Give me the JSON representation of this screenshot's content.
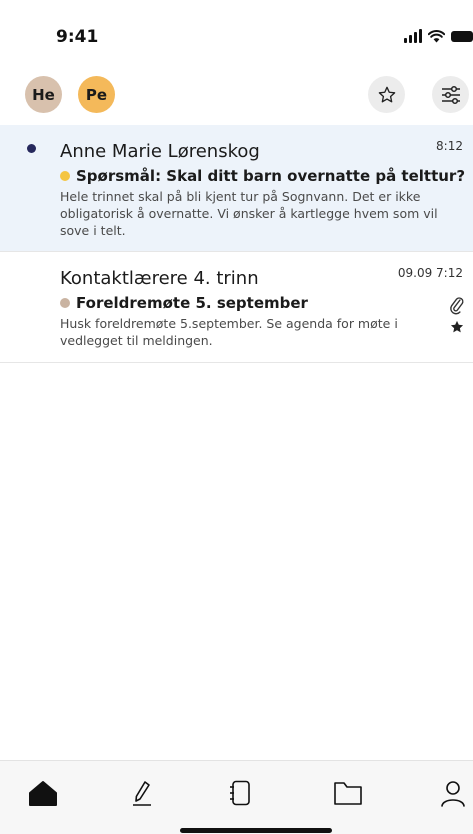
{
  "status_bar": {
    "time": "9:41"
  },
  "header": {
    "avatars": [
      {
        "initials": "He",
        "color": "#d8c1ad"
      },
      {
        "initials": "Pe",
        "color": "#f4b95a"
      }
    ],
    "buttons": [
      "star-icon",
      "filter-icon"
    ]
  },
  "messages": [
    {
      "sender": "Anne Marie Lørenskog",
      "time": "8:12",
      "subject": "Spørsmål: Skal ditt barn overnatte på telttur?",
      "subject_dot_color": "#f4c542",
      "preview": "Hele trinnet skal på bli kjent tur på Sognvann. Det er ikke obligatorisk å overnatte. Vi ønsker å kartlegge hvem som vil sove i telt.",
      "unread": true
    },
    {
      "sender": "Kontaktlærere 4. trinn",
      "time": "09.09 7:12",
      "subject": "Foreldremøte 5. september",
      "subject_dot_color": "#c9b3a1",
      "preview": "Husk foreldremøte 5.september. Se agenda for møte i vedlegget til meldingen.",
      "unread": false,
      "icons": [
        "paperclip-icon",
        "star-filled-icon"
      ]
    }
  ],
  "tabbar": {
    "tabs": [
      "home-icon",
      "pencil-icon",
      "notebook-icon",
      "folder-icon",
      "person-icon"
    ]
  },
  "colors": {
    "unread_bg": "#edf3fa",
    "unread_dot": "#26285c"
  }
}
